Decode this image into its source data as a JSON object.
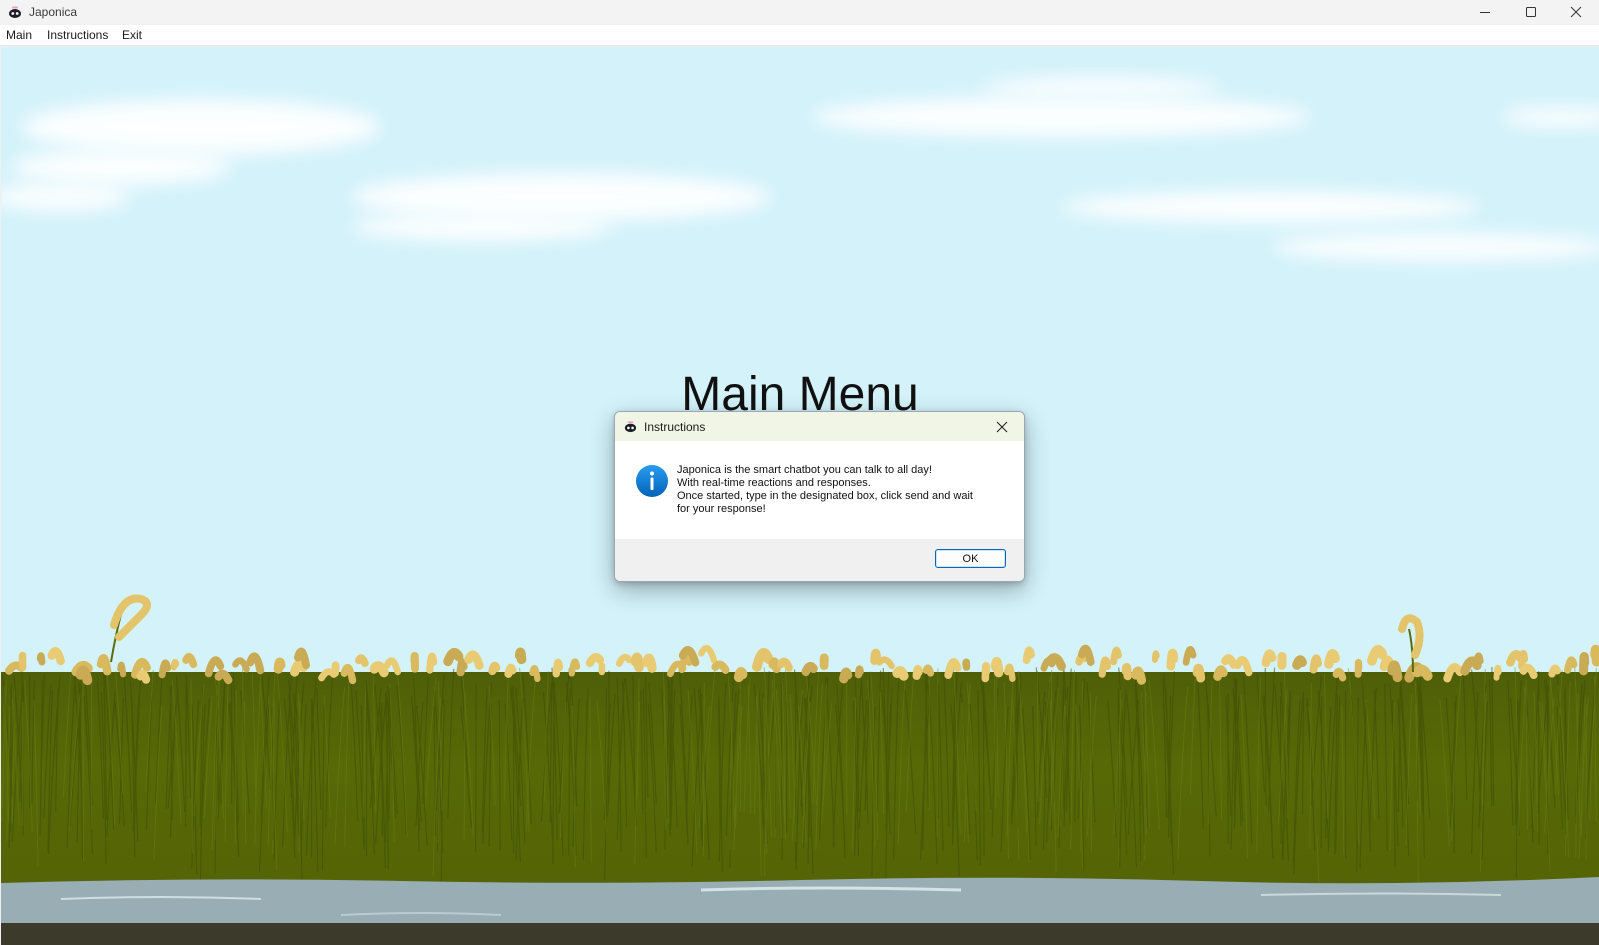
{
  "window": {
    "title": "Japonica",
    "icon": "robot-icon",
    "controls": [
      "minimize-icon",
      "maximize-icon",
      "close-icon"
    ]
  },
  "menubar": {
    "items": [
      {
        "label": "Main"
      },
      {
        "label": "Instructions"
      },
      {
        "label": "Exit"
      }
    ]
  },
  "scene": {
    "heading": "Main Menu",
    "colors": {
      "sky": "#d3f2fa",
      "grass": "#556407",
      "grass_dark": "#4b5a06",
      "seedheads": "#e3c46a",
      "water": "#9ab0b6"
    }
  },
  "dialog": {
    "title": "Instructions",
    "icon": "info-icon",
    "message_lines": [
      "Japonica is the smart chatbot you can talk to all day!",
      "With real-time reactions and responses.",
      "Once started, type in the designated box, click send and wait",
      "for your response!"
    ],
    "ok_label": "OK",
    "accent": "#0078d4"
  }
}
